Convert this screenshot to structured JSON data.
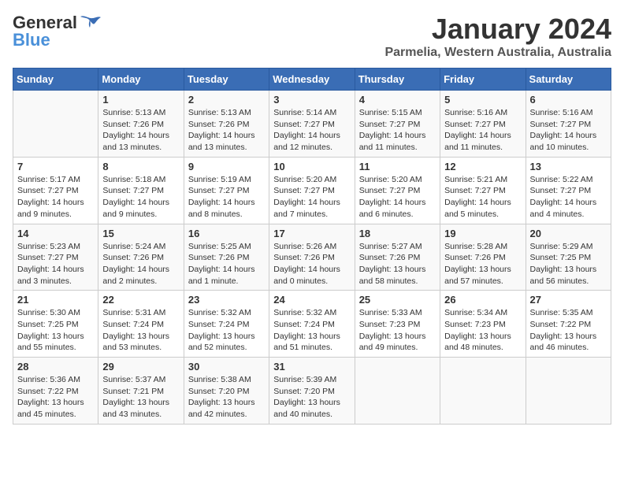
{
  "header": {
    "logo_general": "General",
    "logo_blue": "Blue",
    "title": "January 2024",
    "subtitle": "Parmelia, Western Australia, Australia"
  },
  "calendar": {
    "days_of_week": [
      "Sunday",
      "Monday",
      "Tuesday",
      "Wednesday",
      "Thursday",
      "Friday",
      "Saturday"
    ],
    "weeks": [
      [
        {
          "day": "",
          "info": ""
        },
        {
          "day": "1",
          "info": "Sunrise: 5:13 AM\nSunset: 7:26 PM\nDaylight: 14 hours\nand 13 minutes."
        },
        {
          "day": "2",
          "info": "Sunrise: 5:13 AM\nSunset: 7:26 PM\nDaylight: 14 hours\nand 13 minutes."
        },
        {
          "day": "3",
          "info": "Sunrise: 5:14 AM\nSunset: 7:27 PM\nDaylight: 14 hours\nand 12 minutes."
        },
        {
          "day": "4",
          "info": "Sunrise: 5:15 AM\nSunset: 7:27 PM\nDaylight: 14 hours\nand 11 minutes."
        },
        {
          "day": "5",
          "info": "Sunrise: 5:16 AM\nSunset: 7:27 PM\nDaylight: 14 hours\nand 11 minutes."
        },
        {
          "day": "6",
          "info": "Sunrise: 5:16 AM\nSunset: 7:27 PM\nDaylight: 14 hours\nand 10 minutes."
        }
      ],
      [
        {
          "day": "7",
          "info": "Sunrise: 5:17 AM\nSunset: 7:27 PM\nDaylight: 14 hours\nand 9 minutes."
        },
        {
          "day": "8",
          "info": "Sunrise: 5:18 AM\nSunset: 7:27 PM\nDaylight: 14 hours\nand 9 minutes."
        },
        {
          "day": "9",
          "info": "Sunrise: 5:19 AM\nSunset: 7:27 PM\nDaylight: 14 hours\nand 8 minutes."
        },
        {
          "day": "10",
          "info": "Sunrise: 5:20 AM\nSunset: 7:27 PM\nDaylight: 14 hours\nand 7 minutes."
        },
        {
          "day": "11",
          "info": "Sunrise: 5:20 AM\nSunset: 7:27 PM\nDaylight: 14 hours\nand 6 minutes."
        },
        {
          "day": "12",
          "info": "Sunrise: 5:21 AM\nSunset: 7:27 PM\nDaylight: 14 hours\nand 5 minutes."
        },
        {
          "day": "13",
          "info": "Sunrise: 5:22 AM\nSunset: 7:27 PM\nDaylight: 14 hours\nand 4 minutes."
        }
      ],
      [
        {
          "day": "14",
          "info": "Sunrise: 5:23 AM\nSunset: 7:27 PM\nDaylight: 14 hours\nand 3 minutes."
        },
        {
          "day": "15",
          "info": "Sunrise: 5:24 AM\nSunset: 7:26 PM\nDaylight: 14 hours\nand 2 minutes."
        },
        {
          "day": "16",
          "info": "Sunrise: 5:25 AM\nSunset: 7:26 PM\nDaylight: 14 hours\nand 1 minute."
        },
        {
          "day": "17",
          "info": "Sunrise: 5:26 AM\nSunset: 7:26 PM\nDaylight: 14 hours\nand 0 minutes."
        },
        {
          "day": "18",
          "info": "Sunrise: 5:27 AM\nSunset: 7:26 PM\nDaylight: 13 hours\nand 58 minutes."
        },
        {
          "day": "19",
          "info": "Sunrise: 5:28 AM\nSunset: 7:26 PM\nDaylight: 13 hours\nand 57 minutes."
        },
        {
          "day": "20",
          "info": "Sunrise: 5:29 AM\nSunset: 7:25 PM\nDaylight: 13 hours\nand 56 minutes."
        }
      ],
      [
        {
          "day": "21",
          "info": "Sunrise: 5:30 AM\nSunset: 7:25 PM\nDaylight: 13 hours\nand 55 minutes."
        },
        {
          "day": "22",
          "info": "Sunrise: 5:31 AM\nSunset: 7:24 PM\nDaylight: 13 hours\nand 53 minutes."
        },
        {
          "day": "23",
          "info": "Sunrise: 5:32 AM\nSunset: 7:24 PM\nDaylight: 13 hours\nand 52 minutes."
        },
        {
          "day": "24",
          "info": "Sunrise: 5:32 AM\nSunset: 7:24 PM\nDaylight: 13 hours\nand 51 minutes."
        },
        {
          "day": "25",
          "info": "Sunrise: 5:33 AM\nSunset: 7:23 PM\nDaylight: 13 hours\nand 49 minutes."
        },
        {
          "day": "26",
          "info": "Sunrise: 5:34 AM\nSunset: 7:23 PM\nDaylight: 13 hours\nand 48 minutes."
        },
        {
          "day": "27",
          "info": "Sunrise: 5:35 AM\nSunset: 7:22 PM\nDaylight: 13 hours\nand 46 minutes."
        }
      ],
      [
        {
          "day": "28",
          "info": "Sunrise: 5:36 AM\nSunset: 7:22 PM\nDaylight: 13 hours\nand 45 minutes."
        },
        {
          "day": "29",
          "info": "Sunrise: 5:37 AM\nSunset: 7:21 PM\nDaylight: 13 hours\nand 43 minutes."
        },
        {
          "day": "30",
          "info": "Sunrise: 5:38 AM\nSunset: 7:20 PM\nDaylight: 13 hours\nand 42 minutes."
        },
        {
          "day": "31",
          "info": "Sunrise: 5:39 AM\nSunset: 7:20 PM\nDaylight: 13 hours\nand 40 minutes."
        },
        {
          "day": "",
          "info": ""
        },
        {
          "day": "",
          "info": ""
        },
        {
          "day": "",
          "info": ""
        }
      ]
    ]
  }
}
